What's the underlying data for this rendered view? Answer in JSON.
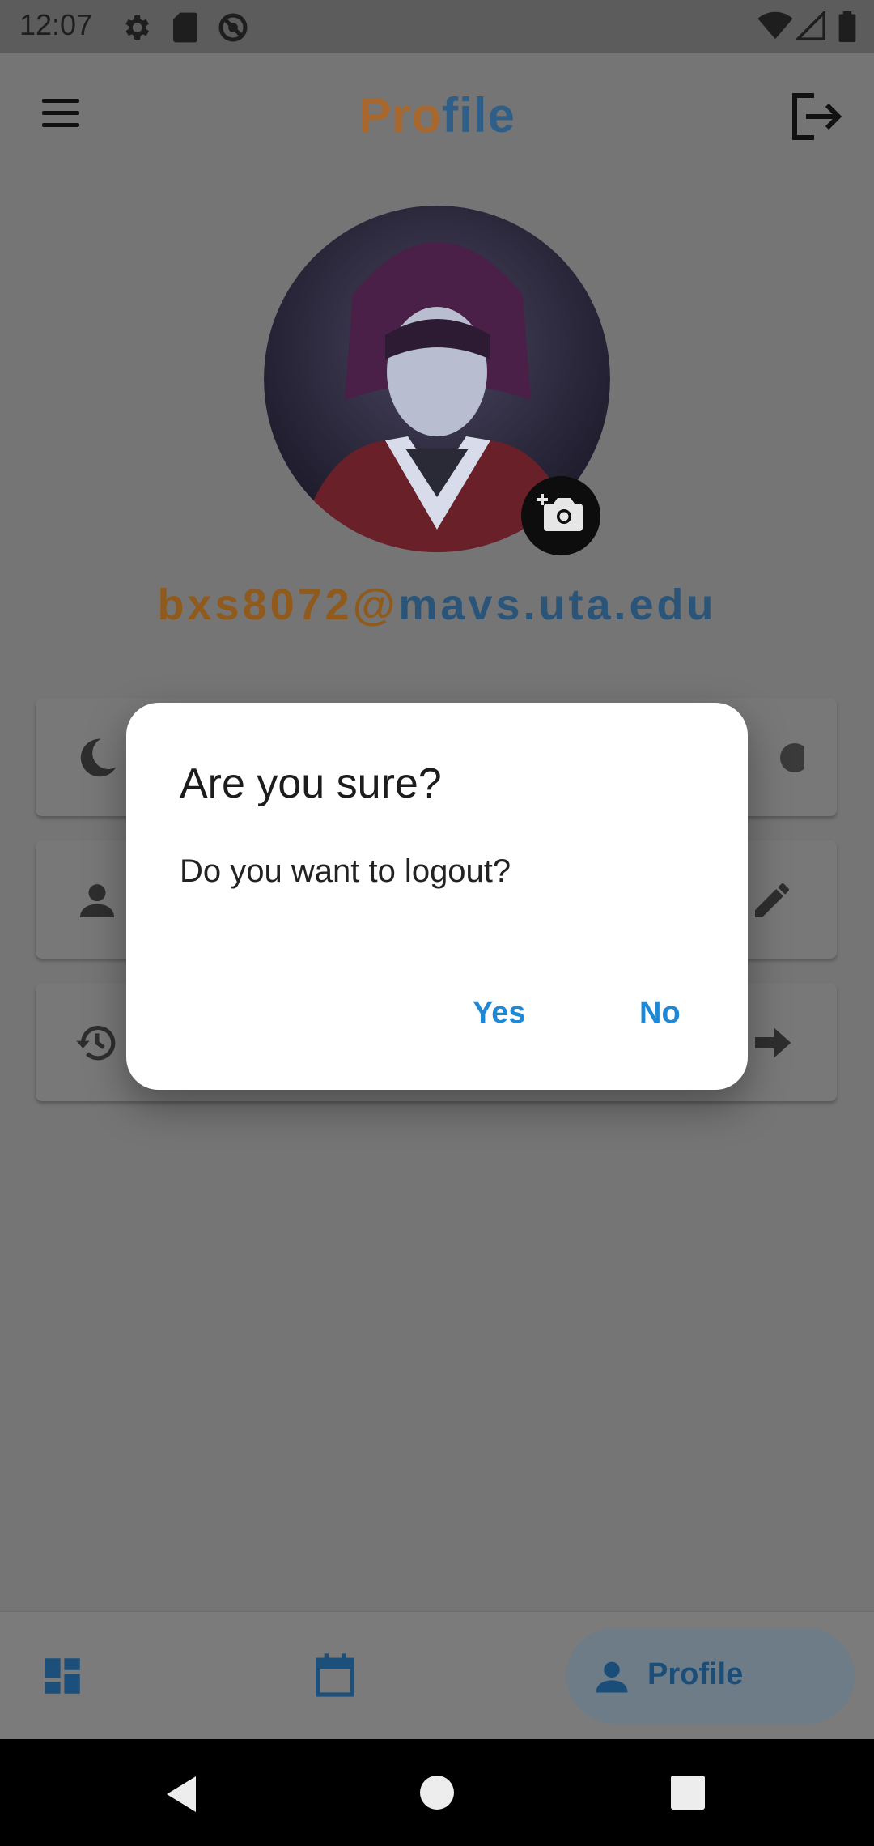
{
  "status_bar": {
    "time": "12:07",
    "left_icons": [
      "gear-icon",
      "sd-card-icon",
      "no-location-icon"
    ],
    "right_icons": [
      "wifi-icon",
      "signal-icon",
      "battery-icon"
    ]
  },
  "header": {
    "title_part1": "Pro",
    "title_part2": "file",
    "menu_icon": "hamburger-menu-icon",
    "logout_icon": "logout-icon"
  },
  "profile": {
    "email_part1": "bxs8072@",
    "email_part2": "mavs.uta.edu",
    "camera_icon": "add-photo-icon"
  },
  "cards": [
    {
      "icon": "moon-icon",
      "trailing": "toggle-switch"
    },
    {
      "icon": "person-icon",
      "trailing": "edit-icon"
    },
    {
      "icon": "history-icon",
      "trailing": "arrow-right-icon"
    }
  ],
  "bottom_nav": {
    "items": [
      {
        "icon": "dashboard-icon"
      },
      {
        "icon": "calendar-icon"
      },
      {
        "icon": "person-icon",
        "label": "Profile",
        "active": true
      }
    ]
  },
  "dialog": {
    "title": "Are you sure?",
    "message": "Do you want to logout?",
    "yes_label": "Yes",
    "no_label": "No"
  },
  "colors": {
    "accent_orange": "#c57a2a",
    "accent_blue": "#2f77b8",
    "dialog_button": "#1f88d6"
  }
}
